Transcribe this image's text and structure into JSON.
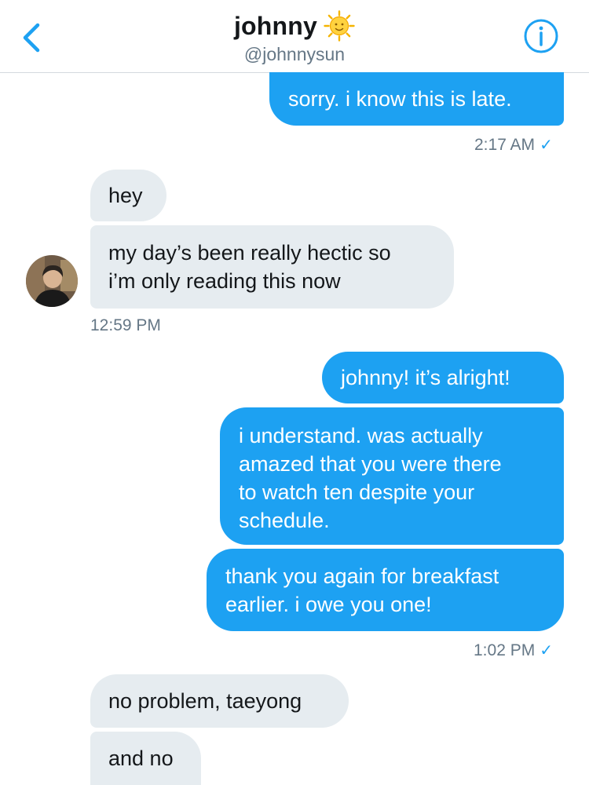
{
  "header": {
    "name": "johnny",
    "handle": "@johnnysun",
    "emoji_icon": "sun-with-face-icon",
    "back_icon": "chevron-left-icon",
    "info_icon": "info-icon",
    "accent": "#1da1f2"
  },
  "messages": [
    {
      "dir": "out",
      "text": "sorry. i know this is late."
    },
    {
      "dir": "in",
      "text": "hey"
    },
    {
      "dir": "in",
      "text": "my day’s been really hectic so\ni’m only reading this now"
    },
    {
      "dir": "out",
      "text": "johnny! it’s alright!"
    },
    {
      "dir": "out",
      "text": "i understand. was actually\namazed that you were there\nto watch ten despite your\nschedule."
    },
    {
      "dir": "out",
      "text": "thank you again for breakfast\nearlier. i owe you one!"
    },
    {
      "dir": "in",
      "text": "no problem, taeyong"
    },
    {
      "dir": "in",
      "text": "and no"
    }
  ],
  "timestamps": [
    {
      "text": "2:17 AM",
      "check": "✓"
    },
    {
      "text": "12:59 PM"
    },
    {
      "text": "1:02 PM",
      "check": "✓"
    }
  ],
  "colors": {
    "outgoing_bubble": "#1da1f2",
    "incoming_bubble": "#e6ecf0",
    "timestamp": "#657786"
  }
}
